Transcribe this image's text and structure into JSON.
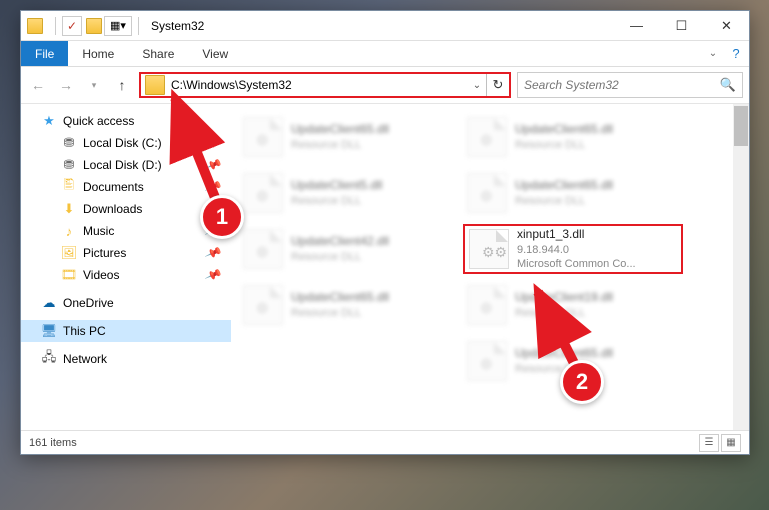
{
  "window": {
    "title": "System32"
  },
  "ribbon": {
    "file": "File",
    "tabs": [
      "Home",
      "Share",
      "View"
    ]
  },
  "nav": {
    "path": "C:\\Windows\\System32",
    "search_placeholder": "Search System32"
  },
  "sidebar": {
    "quick_access": "Quick access",
    "items": [
      {
        "label": "Local Disk (C:)",
        "icon": "disk"
      },
      {
        "label": "Local Disk (D:)",
        "icon": "disk"
      },
      {
        "label": "Documents",
        "icon": "folder"
      },
      {
        "label": "Downloads",
        "icon": "folder"
      },
      {
        "label": "Music",
        "icon": "folder"
      },
      {
        "label": "Pictures",
        "icon": "folder"
      },
      {
        "label": "Videos",
        "icon": "folder"
      }
    ],
    "onedrive": "OneDrive",
    "this_pc": "This PC",
    "network": "Network"
  },
  "files": {
    "blurred": {
      "name": "UpdateClient65.dll",
      "sub": "Resource DLL"
    },
    "variants": [
      {
        "name": "UpdateClient65.dll",
        "sub": "Resource DLL"
      },
      {
        "name": "UpdateClient5.dll",
        "sub": "Resource DLL"
      },
      {
        "name": "UpdateClient42.dll",
        "sub": "Resource DLL"
      },
      {
        "name": "UpdateClient65.dll",
        "sub": "Resource DLL"
      },
      {
        "name": "UpdateClient65.dll",
        "sub": "Resource DLL"
      },
      {
        "name": "UpdateClient65.dll",
        "sub": "Resource DLL"
      },
      {
        "name": "UpdateClient65.dll",
        "sub": "Resource DLL"
      },
      {
        "name": "UpdateClient19.dll",
        "sub": "Resource DLL"
      },
      {
        "name": "UpdateClient65.dll",
        "sub": "Resource DLL"
      }
    ],
    "highlight": {
      "name": "xinput1_3.dll",
      "version": "9.18.944.0",
      "desc": "Microsoft Common Co..."
    }
  },
  "status": {
    "count": "161 items"
  },
  "annotations": {
    "n1": "1",
    "n2": "2"
  }
}
